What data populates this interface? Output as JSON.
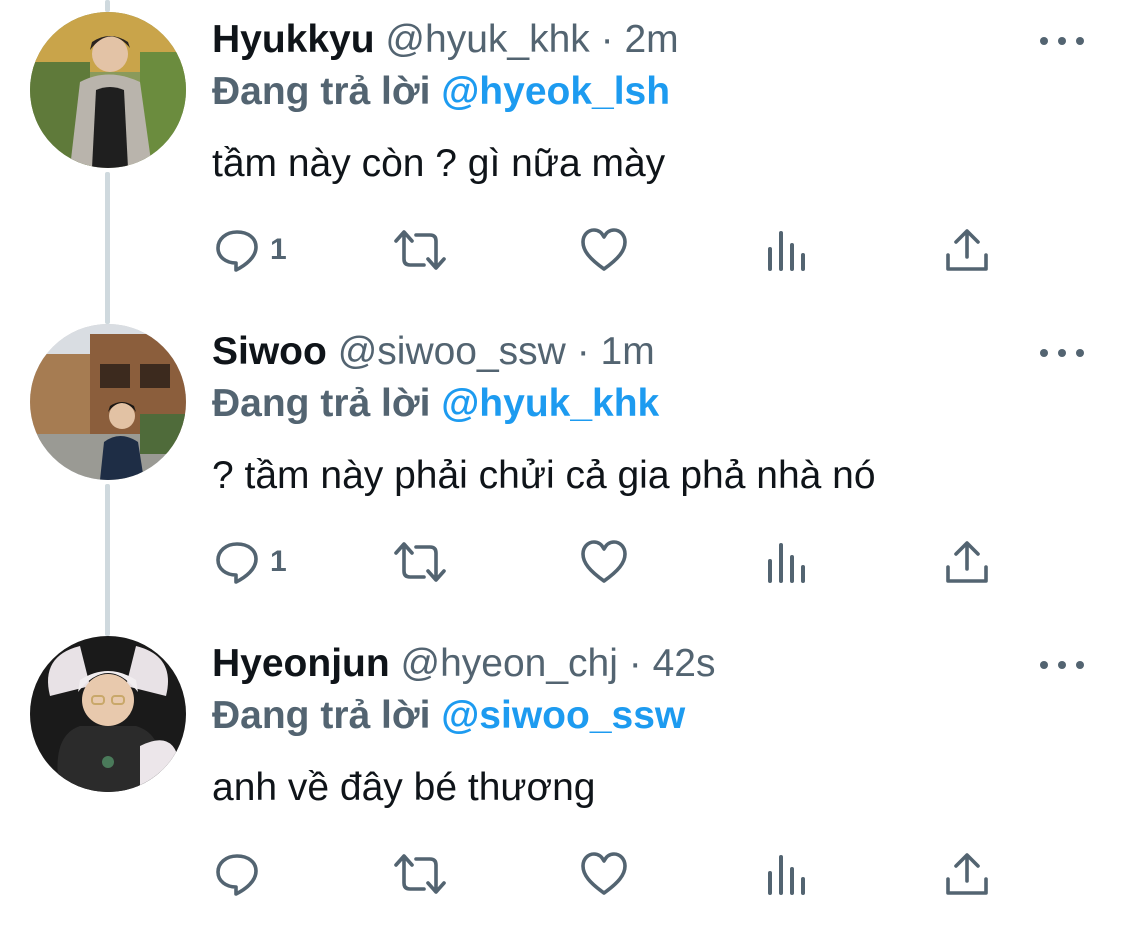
{
  "colors": {
    "text_primary": "#0f1419",
    "text_secondary": "#536471",
    "accent": "#1d9bf0",
    "thread_line": "#cfd9de"
  },
  "tweets": [
    {
      "display_name": "Hyukkyu",
      "handle": "@hyuk_khk",
      "separator": "·",
      "time": "2m",
      "reply_prefix": "Đang trả lời",
      "reply_mention": "@hyeok_lsh",
      "text": "tầm này còn ? gì nữa mày",
      "reply_count": "1",
      "icons": [
        "avatar",
        "more-icon",
        "reply-icon",
        "retweet-icon",
        "like-icon",
        "views-icon",
        "share-icon"
      ]
    },
    {
      "display_name": "Siwoo",
      "handle": "@siwoo_ssw",
      "separator": "·",
      "time": "1m",
      "reply_prefix": "Đang trả lời",
      "reply_mention": "@hyuk_khk",
      "text": "? tầm này phải chửi cả gia phả nhà nó",
      "reply_count": "1",
      "icons": [
        "avatar",
        "more-icon",
        "reply-icon",
        "retweet-icon",
        "like-icon",
        "views-icon",
        "share-icon"
      ]
    },
    {
      "display_name": "Hyeonjun",
      "handle": "@hyeon_chj",
      "separator": "·",
      "time": "42s",
      "reply_prefix": "Đang trả lời",
      "reply_mention": "@siwoo_ssw",
      "text": "anh về đây bé thương",
      "reply_count": "",
      "icons": [
        "avatar",
        "more-icon",
        "reply-icon",
        "retweet-icon",
        "like-icon",
        "views-icon",
        "share-icon"
      ]
    }
  ]
}
